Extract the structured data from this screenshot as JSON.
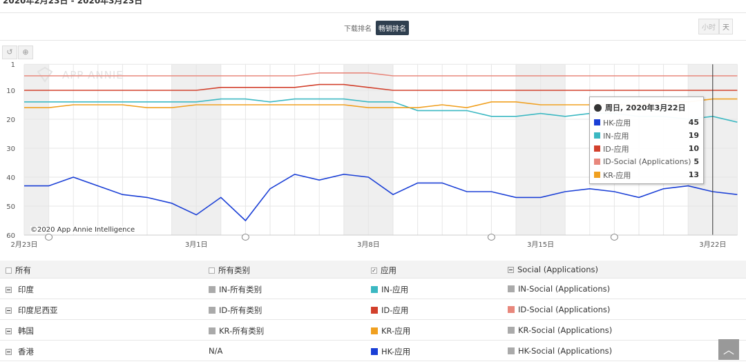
{
  "header": {
    "date_range": "2020年2月23日 - 2020年3月23日"
  },
  "rank_toggle": {
    "options": [
      "下载排名",
      "畅销排名"
    ],
    "selected": "畅销排名"
  },
  "granularity": {
    "options": [
      "小时",
      "天"
    ],
    "selected": "天"
  },
  "toolbar": {
    "reset_icon": "undo-icon",
    "zoom_icon": "zoom-in-icon"
  },
  "watermark": "APP ANNIE",
  "copyright": "©2020 App Annie Intelligence",
  "tooltip": {
    "title": "周日, 2020年3月22日",
    "icon": "globe-icon",
    "rows": [
      {
        "label": "HK-应用",
        "value": "45",
        "color": "#1a3fd6"
      },
      {
        "label": "IN-应用",
        "value": "19",
        "color": "#3bb8c2"
      },
      {
        "label": "ID-应用",
        "value": "10",
        "color": "#d2402c"
      },
      {
        "label": "ID-Social (Applications)",
        "value": "5",
        "color": "#e8877c"
      },
      {
        "label": "KR-应用",
        "value": "13",
        "color": "#f0a020"
      }
    ]
  },
  "chart_data": {
    "type": "line",
    "x": [
      "2月23日",
      "2月24日",
      "2月25日",
      "2月26日",
      "2月27日",
      "2月28日",
      "2月29日",
      "3月1日",
      "3月2日",
      "3月3日",
      "3月4日",
      "3月5日",
      "3月6日",
      "3月7日",
      "3月8日",
      "3月9日",
      "3月10日",
      "3月11日",
      "3月12日",
      "3月13日",
      "3月14日",
      "3月15日",
      "3月16日",
      "3月17日",
      "3月18日",
      "3月19日",
      "3月20日",
      "3月21日",
      "3月22日",
      "3月23日"
    ],
    "x_tick_labels": [
      "2月23日",
      "3月1日",
      "3月8日",
      "3月15日",
      "3月22日"
    ],
    "y_tick_labels": [
      "1",
      "10",
      "20",
      "30",
      "40",
      "50",
      "60"
    ],
    "ylim": [
      1,
      60
    ],
    "y_reversed": true,
    "grid": true,
    "series": [
      {
        "name": "ID-Social (Applications)",
        "color": "#e8877c",
        "values": [
          5,
          5,
          5,
          5,
          5,
          5,
          5,
          5,
          5,
          5,
          5,
          5,
          4,
          4,
          4,
          5,
          5,
          5,
          5,
          5,
          5,
          5,
          5,
          5,
          5,
          5,
          5,
          5,
          5,
          5
        ]
      },
      {
        "name": "ID-应用",
        "color": "#d2402c",
        "values": [
          10,
          10,
          10,
          10,
          10,
          10,
          10,
          10,
          9,
          9,
          9,
          9,
          8,
          8,
          9,
          10,
          10,
          10,
          10,
          10,
          10,
          10,
          10,
          10,
          10,
          10,
          10,
          10,
          10,
          10
        ]
      },
      {
        "name": "IN-应用",
        "color": "#3bb8c2",
        "values": [
          14,
          14,
          14,
          14,
          14,
          14,
          14,
          14,
          13,
          13,
          14,
          13,
          13,
          13,
          14,
          14,
          17,
          17,
          17,
          19,
          19,
          18,
          19,
          18,
          18,
          19,
          19,
          20,
          19,
          21
        ]
      },
      {
        "name": "KR-应用",
        "color": "#f0a020",
        "values": [
          16,
          16,
          15,
          15,
          15,
          16,
          16,
          15,
          15,
          15,
          15,
          15,
          15,
          15,
          16,
          16,
          16,
          15,
          16,
          14,
          14,
          15,
          15,
          15,
          15,
          15,
          14,
          14,
          13,
          13
        ]
      },
      {
        "name": "HK-应用",
        "color": "#1a3fd6",
        "values": [
          43,
          43,
          40,
          43,
          46,
          47,
          49,
          53,
          47,
          55,
          44,
          39,
          41,
          39,
          40,
          46,
          42,
          42,
          45,
          45,
          47,
          47,
          45,
          44,
          45,
          47,
          44,
          43,
          45,
          46
        ]
      }
    ],
    "annotations_on_dates": [
      "2月24日",
      "3月3日",
      "3月13日",
      "3月18日"
    ],
    "crosshair_date": "3月22日"
  },
  "table": {
    "headers": [
      {
        "label": "所有",
        "check": "unchecked"
      },
      {
        "label": "所有类别",
        "check": "unchecked"
      },
      {
        "label": "应用",
        "check": "checked"
      },
      {
        "label": "Social (Applications)",
        "check": "partial"
      }
    ],
    "rows": [
      {
        "country": "印度",
        "cells": [
          {
            "label": "IN-所有类别",
            "color": "#aaaaaa"
          },
          {
            "label": "IN-应用",
            "color": "#3bb8c2"
          },
          {
            "label": "IN-Social (Applications)",
            "color": "#aaaaaa"
          }
        ]
      },
      {
        "country": "印度尼西亚",
        "cells": [
          {
            "label": "ID-所有类别",
            "color": "#aaaaaa"
          },
          {
            "label": "ID-应用",
            "color": "#d2402c"
          },
          {
            "label": "ID-Social (Applications)",
            "color": "#e8877c"
          }
        ]
      },
      {
        "country": "韩国",
        "cells": [
          {
            "label": "KR-所有类别",
            "color": "#aaaaaa"
          },
          {
            "label": "KR-应用",
            "color": "#f0a020"
          },
          {
            "label": "KR-Social (Applications)",
            "color": "#aaaaaa"
          }
        ]
      },
      {
        "country": "香港",
        "cells": [
          {
            "label": "N/A",
            "color": ""
          },
          {
            "label": "HK-应用",
            "color": "#1a3fd6"
          },
          {
            "label": "HK-Social (Applications)",
            "color": "#aaaaaa"
          }
        ]
      }
    ]
  }
}
